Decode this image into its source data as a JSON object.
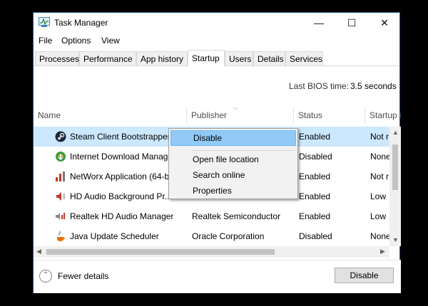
{
  "window": {
    "title": "Task Manager",
    "minimize": "—",
    "maximize": "☐",
    "close": "✕"
  },
  "menu": [
    "File",
    "Options",
    "View"
  ],
  "tabs": [
    "Processes",
    "Performance",
    "App history",
    "Startup",
    "Users",
    "Details",
    "Services"
  ],
  "active_tab": "Startup",
  "bios": {
    "label": "Last BIOS time:",
    "value": "3.5 seconds"
  },
  "columns": {
    "name": "Name",
    "publisher": "Publisher",
    "status": "Status",
    "impact": "Startup i"
  },
  "rows": [
    {
      "name": "Steam Client Bootstrapper",
      "publisher": "",
      "status": "Enabled",
      "impact": "Not r",
      "icon": "steam-icon",
      "selected": true
    },
    {
      "name": "Internet Download Manag",
      "publisher": "",
      "status": "Disabled",
      "impact": "None",
      "icon": "idm-icon"
    },
    {
      "name": "NetWorx Application (64-b",
      "publisher": "",
      "status": "Enabled",
      "impact": "Not r",
      "icon": "networx-icon"
    },
    {
      "name": "HD Audio Background Pr...",
      "publisher": "",
      "status": "Enabled",
      "impact": "Low",
      "icon": "speaker-icon"
    },
    {
      "name": "Realtek HD Audio Manager",
      "publisher": "Realtek Semiconductor",
      "status": "Enabled",
      "impact": "Low",
      "icon": "realtek-icon"
    },
    {
      "name": "Java Update Scheduler",
      "publisher": "Oracle Corporation",
      "status": "Disabled",
      "impact": "None",
      "icon": "java-icon"
    }
  ],
  "context_menu": {
    "disable": "Disable",
    "open_location": "Open file location",
    "search_online": "Search online",
    "properties": "Properties"
  },
  "footer": {
    "fewer_details": "Fewer details",
    "disable_button": "Disable"
  },
  "colors": {
    "selection": "#cce8ff",
    "menu_highlight": "#91c9f7",
    "border": "#1d5f9e"
  }
}
